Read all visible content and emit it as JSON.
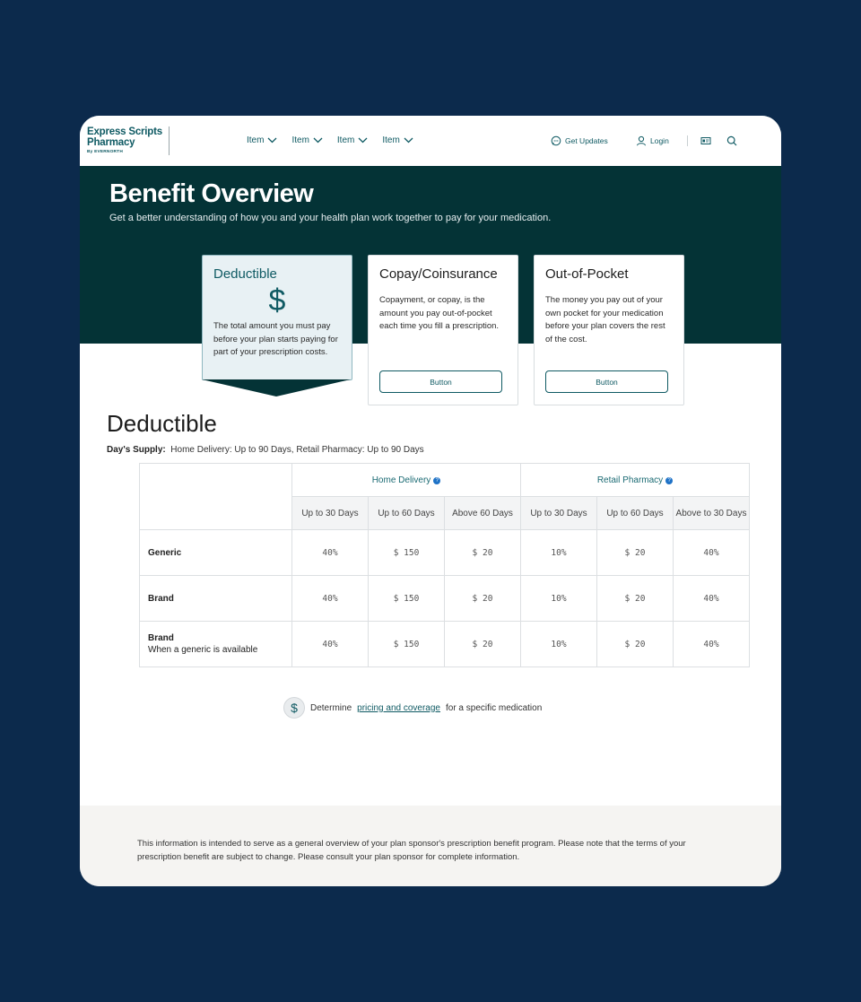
{
  "brand": {
    "name_line1": "Express Scripts",
    "name_line2": "Pharmacy",
    "tagline": "By EVERNORTH",
    "primary_color": "#0f5a63",
    "hero_color": "#043336",
    "page_bg": "#0c2a4c"
  },
  "nav": {
    "items": [
      {
        "label": "Item",
        "icon": "chevron-down-icon"
      },
      {
        "label": "Item",
        "icon": "chevron-down-icon"
      },
      {
        "label": "Item",
        "icon": "chevron-down-icon"
      },
      {
        "label": "Item",
        "icon": "chevron-down-icon"
      }
    ],
    "updates_label": "Get Updates",
    "login_label": "Login"
  },
  "hero": {
    "title": "Benefit Overview",
    "subtitle": "Get a better understanding of how you and your health plan work together to pay for your medication."
  },
  "cards": [
    {
      "title": "Deductible",
      "icon": "dollar-icon",
      "text": "The total amount you must pay before your plan starts paying for part of your prescription costs.",
      "active": true
    },
    {
      "title": "Copay/Coinsurance",
      "text": "Copayment, or copay, is the amount you pay out-of-pocket each time you fill a prescription.",
      "button": "Button"
    },
    {
      "title": "Out-of-Pocket",
      "text": "The money you pay out of your own pocket for your medication before your plan covers the rest of the cost.",
      "button": "Button"
    }
  ],
  "section": {
    "title": "Deductible",
    "supply_label": "Day's Supply:",
    "supply_text": "Home Delivery: Up to 90 Days, Retail Pharmacy: Up to 90 Days"
  },
  "table": {
    "groups": [
      "Home Delivery",
      "Retail Pharmacy"
    ],
    "sub_headers": [
      "Up to 30 Days",
      "Up to 60 Days",
      "Above 60 Days",
      "Up to 30 Days",
      "Up to 60 Days",
      "Above to 30 Days"
    ],
    "rows": [
      {
        "label": "Generic",
        "sub": "",
        "values": [
          "40%",
          "$ 150",
          "$ 20",
          "10%",
          "$ 20",
          "40%"
        ]
      },
      {
        "label": "Brand",
        "sub": "",
        "values": [
          "40%",
          "$ 150",
          "$ 20",
          "10%",
          "$ 20",
          "40%"
        ]
      },
      {
        "label": "Brand",
        "sub": "When a generic is available",
        "values": [
          "40%",
          "$ 150",
          "$ 20",
          "10%",
          "$ 20",
          "40%"
        ]
      }
    ]
  },
  "pricing": {
    "prefix": "Determine",
    "link": "pricing and coverage",
    "suffix": "for a specific medication"
  },
  "footer": {
    "text": "This information is intended to serve as a general overview of your plan sponsor's prescription benefit program. Please note that the terms of your prescription benefit are subject to change. Please consult your plan sponsor for complete information."
  }
}
